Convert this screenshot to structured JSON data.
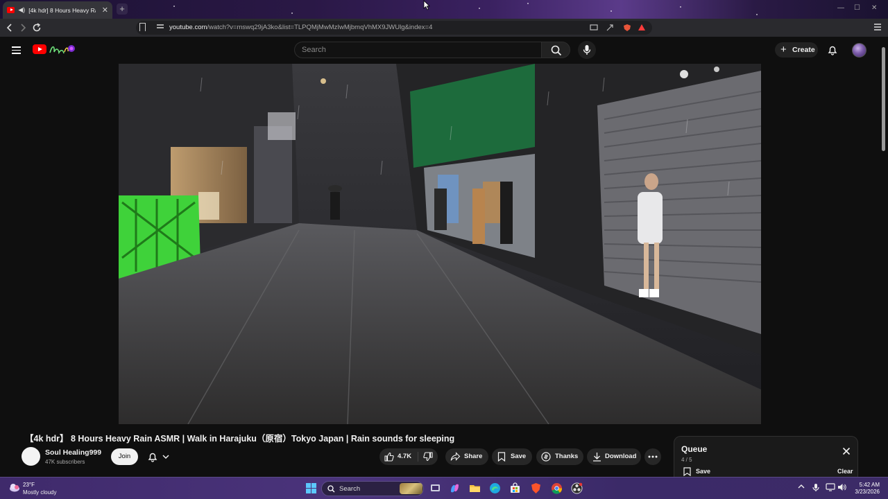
{
  "browser": {
    "tab_title": "[4k hdr] 8 Hours Heavy Rain",
    "new_tab": "+",
    "url_host": "youtube.com",
    "url_path": "/watch?v=mswq29jA3ko&list=TLPQMjMwMzIwMjbmqVhMX9JWUlg&index=4"
  },
  "youtube": {
    "search_placeholder": "Search",
    "create_label": "Create"
  },
  "video": {
    "title": "【4k hdr】 8 Hours Heavy Rain ASMR | Walk in Harajuku（原宿）Tokyo Japan | Rain sounds for sleeping",
    "channel_name": "Soul Healing999",
    "subscribers": "47K subscribers",
    "join_label": "Join",
    "like_count": "4.7K",
    "share_label": "Share",
    "save_label": "Save",
    "thanks_label": "Thanks",
    "download_label": "Download"
  },
  "queue": {
    "title": "Queue",
    "position": "4 / 5",
    "save_label": "Save",
    "clear_label": "Clear"
  },
  "taskbar": {
    "temperature": "23°F",
    "weather": "Mostly cloudy",
    "search_label": "Search",
    "time": "5:42 AM",
    "date": "3/23/2026"
  },
  "colors": {
    "youtube_red": "#ff0000",
    "background": "#0f0f0f",
    "pill": "#272727",
    "taskbar": "#3f2a6b"
  }
}
